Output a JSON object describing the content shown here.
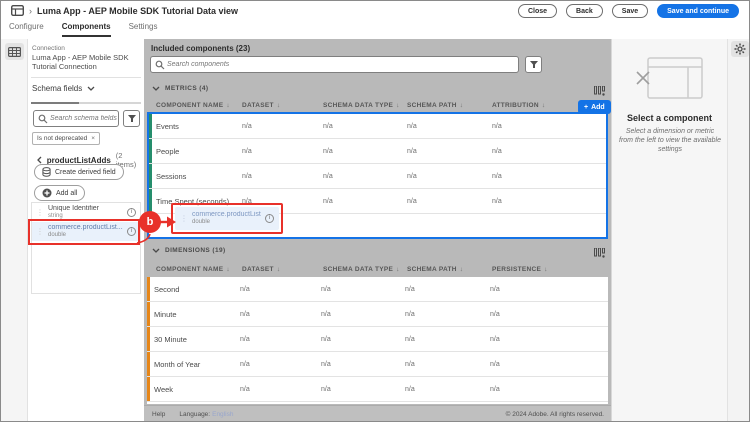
{
  "colors": {
    "accent_blue": "#1473e6",
    "annotation_red": "#e8312a",
    "metric_green": "#268e6c",
    "dimension_orange": "#e68619",
    "workspace_gray": "#b9b9b9"
  },
  "icons": {
    "sort_arrow": "↓",
    "breadcrumb_separator": "›",
    "tag_close": "×",
    "plus": "+",
    "drag_handle": "⋮",
    "info": "i"
  },
  "topbar": {
    "title": "Luma App - AEP Mobile SDK Tutorial Data view",
    "tabs": [
      {
        "label": "Configure"
      },
      {
        "label": "Components"
      },
      {
        "label": "Settings"
      }
    ],
    "buttons": {
      "close": "Close",
      "back": "Back",
      "save": "Save",
      "save_continue": "Save and continue"
    }
  },
  "sidebar": {
    "connection_label": "Connection",
    "connection_name": "Luma App - AEP Mobile SDK Tutorial Connection",
    "schema_fields_label": "Schema fields",
    "search_placeholder": "Search schema fields",
    "filter_tag": "Is not deprecated",
    "group": {
      "name": "productListAdds",
      "count": "(2 items)"
    },
    "create_derived_field_label": "Create derived field",
    "add_all_label": "Add all",
    "fields": [
      {
        "name": "Unique Identifier",
        "type": "string"
      },
      {
        "name": "commerce.productList...",
        "type": "double"
      }
    ]
  },
  "main": {
    "title": "Included components (23)",
    "search_placeholder": "Search components",
    "metrics": {
      "section_title": "METRICS (4)",
      "add_button_label": "Add",
      "columns": [
        "COMPONENT NAME",
        "DATASET",
        "SCHEMA DATA TYPE",
        "SCHEMA PATH",
        "ATTRIBUTION"
      ],
      "rows": [
        [
          "Events",
          "n/a",
          "n/a",
          "n/a",
          "n/a"
        ],
        [
          "People",
          "n/a",
          "n/a",
          "n/a",
          "n/a"
        ],
        [
          "Sessions",
          "n/a",
          "n/a",
          "n/a",
          "n/a"
        ],
        [
          "Time Spent (seconds)",
          "n/a",
          "n/a",
          "n/a",
          "n/a"
        ]
      ]
    },
    "drag_item": {
      "name": "commerce.productList...",
      "type": "double"
    },
    "dimensions": {
      "section_title": "DIMENSIONS (19)",
      "columns": [
        "COMPONENT NAME",
        "DATASET",
        "SCHEMA DATA TYPE",
        "SCHEMA PATH",
        "PERSISTENCE"
      ],
      "rows": [
        [
          "Second",
          "n/a",
          "n/a",
          "n/a",
          "n/a"
        ],
        [
          "Minute",
          "n/a",
          "n/a",
          "n/a",
          "n/a"
        ],
        [
          "30 Minute",
          "n/a",
          "n/a",
          "n/a",
          "n/a"
        ],
        [
          "Month of Year",
          "n/a",
          "n/a",
          "n/a",
          "n/a"
        ],
        [
          "Week",
          "n/a",
          "n/a",
          "n/a",
          "n/a"
        ]
      ]
    },
    "footer": {
      "help": "Help",
      "language_label": "Language:",
      "language_value": "English",
      "copyright": "© 2024 Adobe. All rights reserved."
    }
  },
  "right_panel": {
    "title": "Select a component",
    "subtitle": "Select a dimension or metric from the left to view the available settings"
  },
  "annotation": {
    "label": "b"
  }
}
